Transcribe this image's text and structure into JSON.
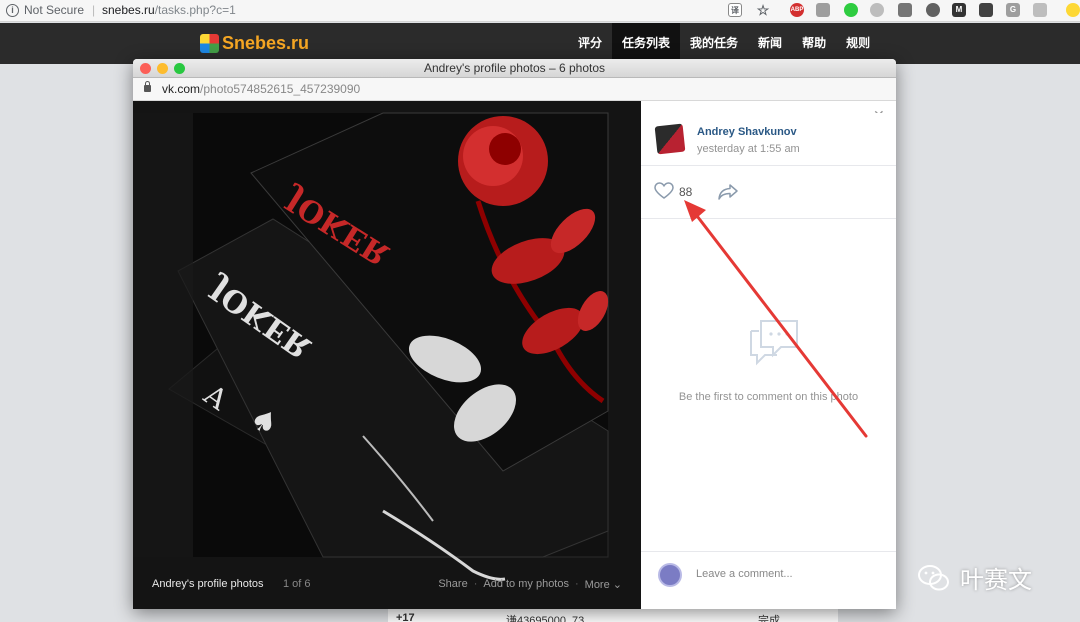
{
  "browser": {
    "security": "Not Secure",
    "url_host": "snebes.ru",
    "url_path": "/tasks.php?c=1"
  },
  "site": {
    "logo": "Snebes",
    "logo_tld": ".ru",
    "nav": [
      "评分",
      "任务列表",
      "我的任务",
      "新闻",
      "帮助",
      "规则"
    ],
    "active_nav": "任务列表"
  },
  "popup": {
    "window_title": "Andrey's profile photos – 6 photos",
    "url_host": "vk.com",
    "url_path": "/photo574852615_457239090",
    "album": "Andrey's profile photos",
    "position": "1 of 6",
    "actions": [
      "Share",
      "Add to my photos",
      "More"
    ],
    "author": "Andrey Shavkunov",
    "posted": "yesterday at 1:55 am",
    "likes": "88",
    "empty_comments": "Be the first to comment on this photo",
    "comment_placeholder": "Leave a comment..."
  },
  "background_row": {
    "score": "+17",
    "user": "谦43695000_73",
    "status": "完成"
  },
  "watermark": "叶赛文",
  "colors": {
    "site_header": "#2b2b2b",
    "vk_link": "#2a5885",
    "annotation_arrow": "#e53935"
  }
}
